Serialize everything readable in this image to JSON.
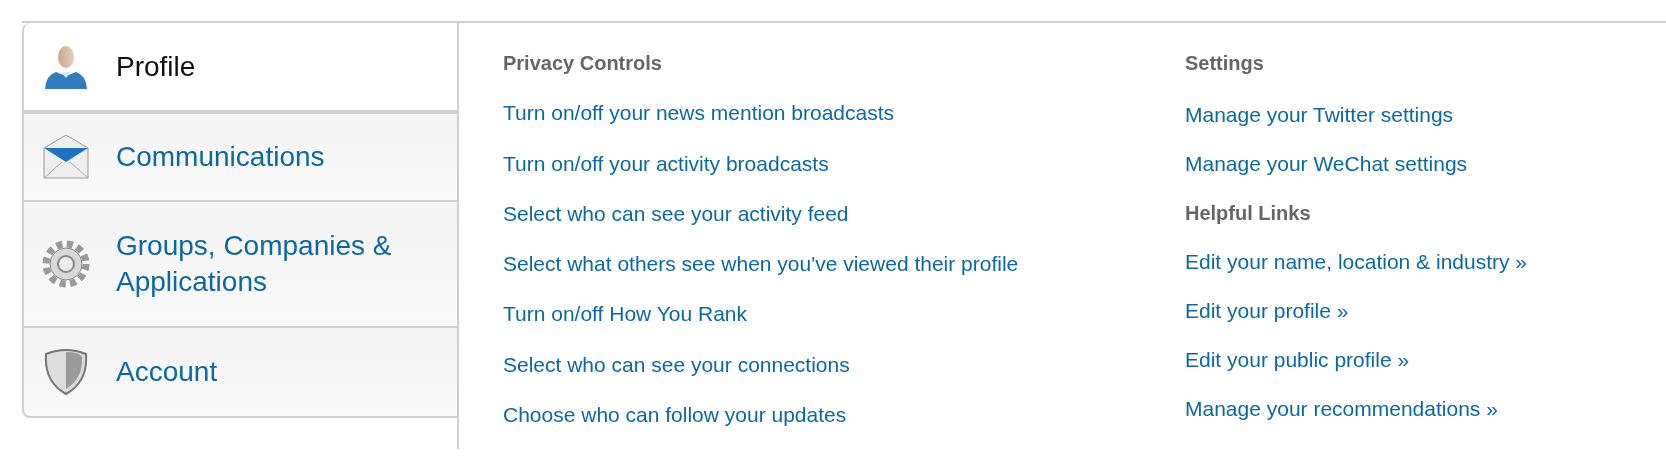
{
  "tabs": [
    {
      "label": "Profile",
      "selected": true
    },
    {
      "label": "Communications",
      "selected": false
    },
    {
      "label": "Groups, Companies & Applications",
      "selected": false
    },
    {
      "label": "Account",
      "selected": false
    }
  ],
  "privacy_controls": {
    "heading": "Privacy Controls",
    "links": [
      "Turn on/off your news mention broadcasts",
      "Turn on/off your activity broadcasts",
      "Select who can see your activity feed",
      "Select what others see when you've viewed their profile",
      "Turn on/off How You Rank",
      "Select who can see your connections",
      "Choose who can follow your updates"
    ]
  },
  "settings": {
    "heading": "Settings",
    "links": [
      "Manage your Twitter settings",
      "Manage your WeChat settings"
    ]
  },
  "helpful_links": {
    "heading": "Helpful Links",
    "links": [
      "Edit your name, location & industry »",
      "Edit your profile »",
      "Edit your public profile »",
      "Manage your recommendations »"
    ]
  }
}
